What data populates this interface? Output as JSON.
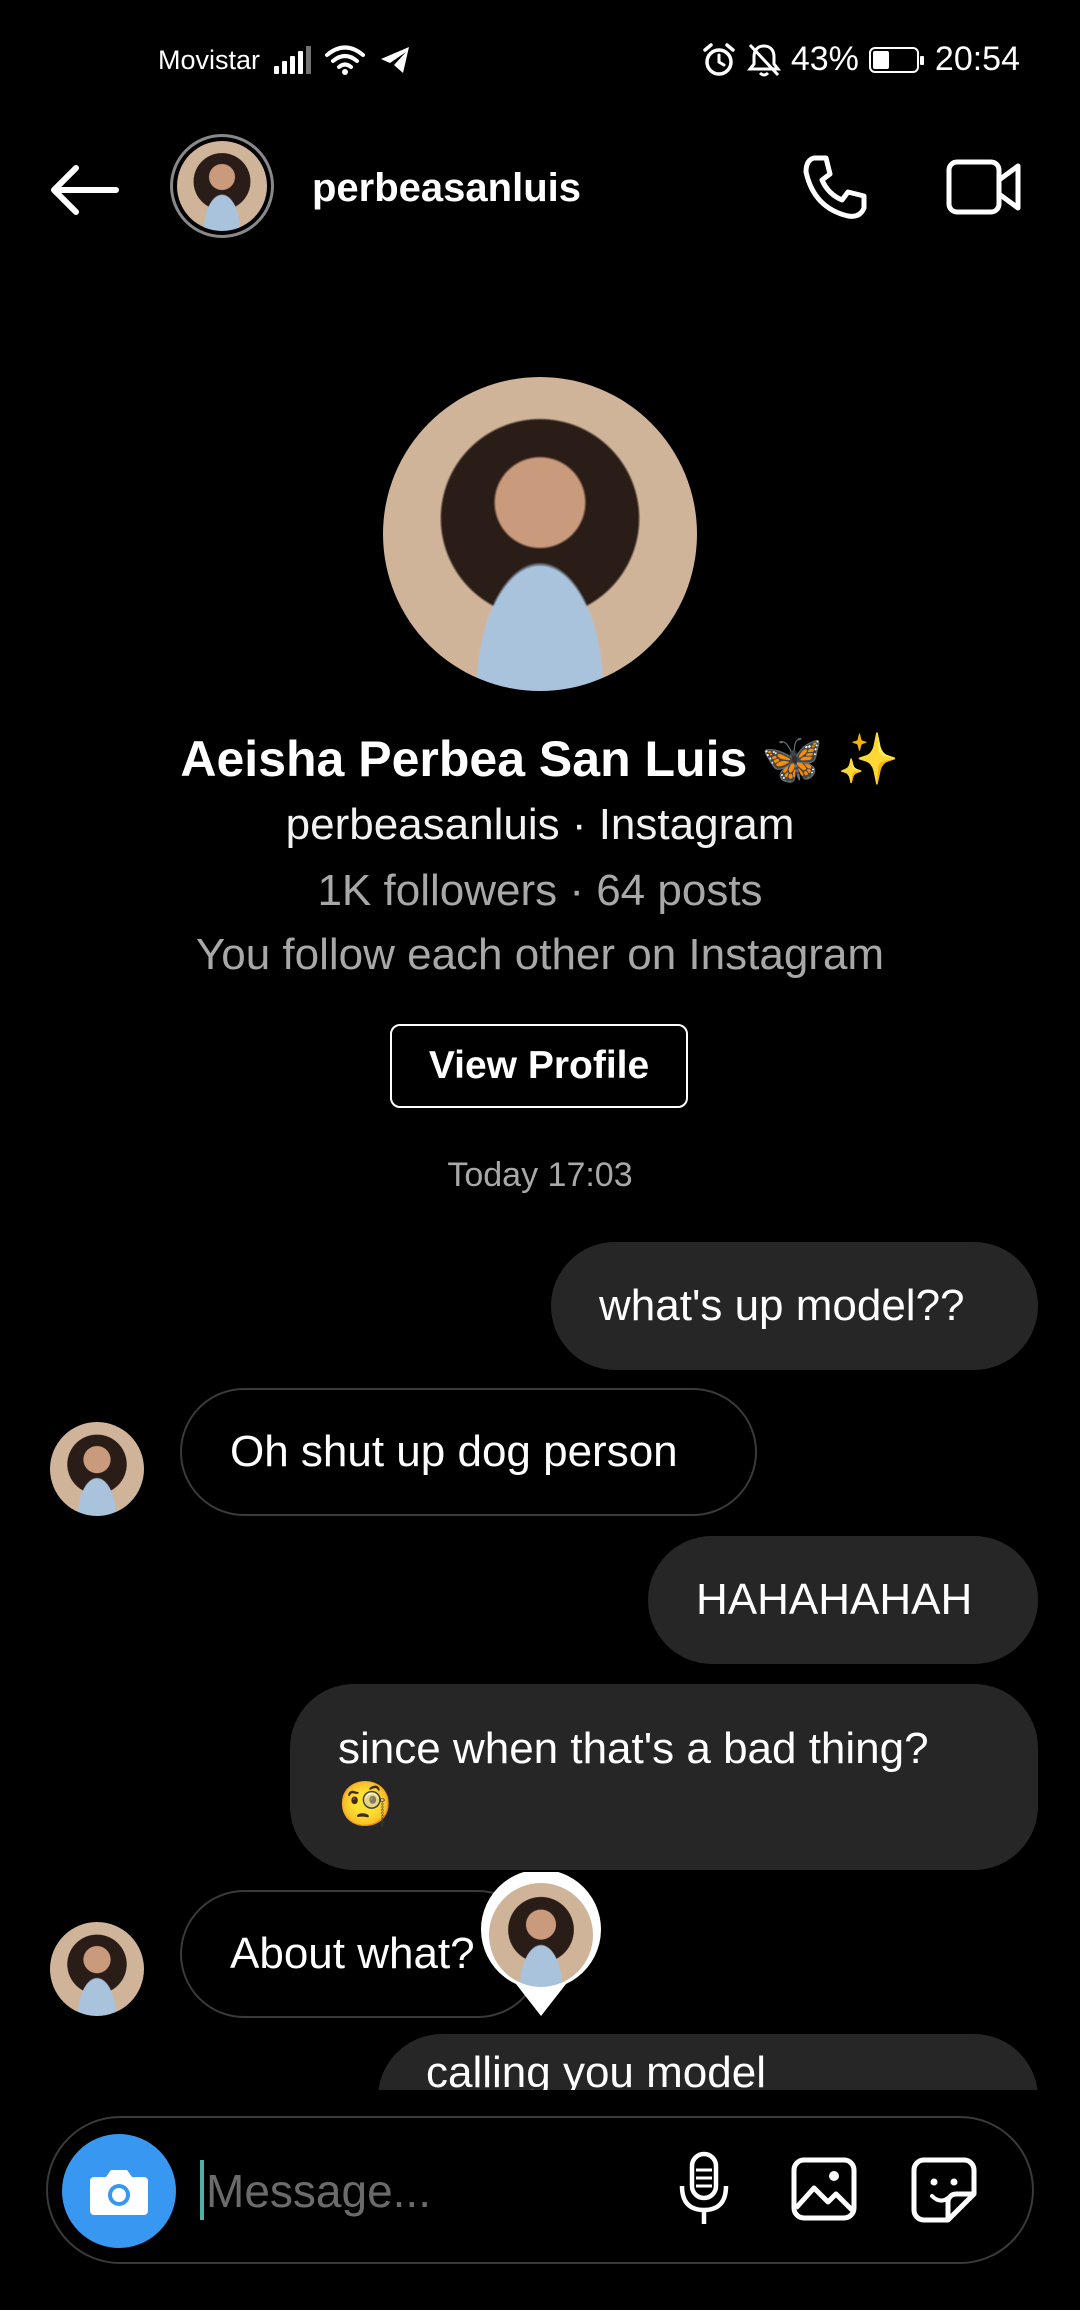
{
  "status_bar": {
    "carrier": "Movistar",
    "battery_percent": "43%",
    "battery_level": 0.43,
    "time": "20:54"
  },
  "header": {
    "username": "perbeasanluis"
  },
  "profile": {
    "full_name": "Aeisha Perbea San Luis 🦋 ✨",
    "username_platform": "perbeasanluis · Instagram",
    "stats": "1K followers · 64 posts",
    "follow_status": "You follow each other on Instagram",
    "view_profile_label": "View Profile"
  },
  "timestamp": "Today 17:03",
  "messages": [
    {
      "direction": "sent",
      "text": "what's up model??"
    },
    {
      "direction": "received",
      "text": "Oh shut up dog person"
    },
    {
      "direction": "sent",
      "text": "HAHAHAHAH"
    },
    {
      "direction": "sent",
      "text": "since when that's a bad thing?",
      "text2": "🧐"
    },
    {
      "direction": "received",
      "text": "About what?"
    },
    {
      "direction": "sent",
      "text": "calling you model HAHAHAH"
    }
  ],
  "composer": {
    "placeholder": "Message..."
  },
  "icons": {
    "back": "arrow-left-icon",
    "call": "phone-icon",
    "video": "video-camera-icon",
    "camera": "camera-icon",
    "mic": "microphone-icon",
    "gallery": "image-icon",
    "sticker": "sticker-icon"
  },
  "colors": {
    "background": "#000000",
    "sent_bubble": "#262626",
    "received_border": "#3a3a3a",
    "camera_button": "#3897f0",
    "secondary_text": "#a8a8a8"
  }
}
